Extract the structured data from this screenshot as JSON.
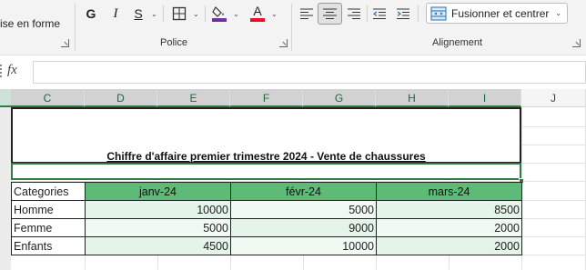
{
  "ribbon": {
    "left_cut_label": "ise en forme",
    "font_group_label": "Police",
    "alignment_group_label": "Alignement",
    "bold_label": "G",
    "italic_label": "I",
    "underline_label": "S",
    "font_color_letter": "A",
    "merge_label": "Fusionner et centrer",
    "colors": {
      "highlight_bar": "#7030a0",
      "font_color_bar": "#e81123",
      "merge_icon": "#1f6fb5"
    }
  },
  "formula_bar": {
    "fx_label": "fx",
    "value": ""
  },
  "columns": [
    "C",
    "D",
    "E",
    "F",
    "G",
    "H",
    "I",
    "J"
  ],
  "sheet": {
    "title": "Chiffre d'affaire premier trimestre 2024 - Vente de chaussures",
    "table": {
      "headers": [
        "Categories",
        "janv-24",
        "févr-24",
        "mars-24"
      ],
      "rows": [
        {
          "category": "Homme",
          "values": [
            "10000",
            "5000",
            "8500"
          ]
        },
        {
          "category": "Femme",
          "values": [
            "5000",
            "9000",
            "2000"
          ]
        },
        {
          "category": "Enfants",
          "values": [
            "4500",
            "10000",
            "2000"
          ]
        }
      ]
    },
    "colors": {
      "header_fill": "#5dbb77",
      "selection_border": "#2f7a45"
    }
  }
}
